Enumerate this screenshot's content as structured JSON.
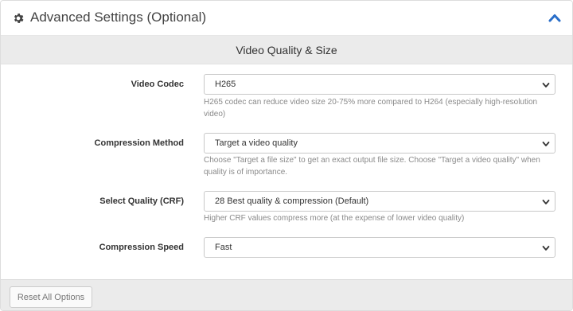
{
  "header": {
    "title": "Advanced Settings (Optional)",
    "gear_icon": "gear-icon",
    "collapse_icon": "chevron-up-icon",
    "accent_color": "#2a6fc9"
  },
  "section": {
    "title": "Video Quality & Size"
  },
  "fields": {
    "video_codec": {
      "label": "Video Codec",
      "value": "H265",
      "help": "H265 codec can reduce video size 20-75% more compared to H264 (especially high-resolution video)"
    },
    "compression_method": {
      "label": "Compression Method",
      "value": "Target a video quality",
      "help": "Choose \"Target a file size\" to get an exact output file size. Choose \"Target a video quality\" when quality is of importance."
    },
    "quality_crf": {
      "label": "Select Quality (CRF)",
      "value": "28 Best quality & compression (Default)",
      "help": "Higher CRF values compress more (at the expense of lower video quality)"
    },
    "compression_speed": {
      "label": "Compression Speed",
      "value": "Fast"
    }
  },
  "footer": {
    "reset_label": "Reset All Options"
  }
}
